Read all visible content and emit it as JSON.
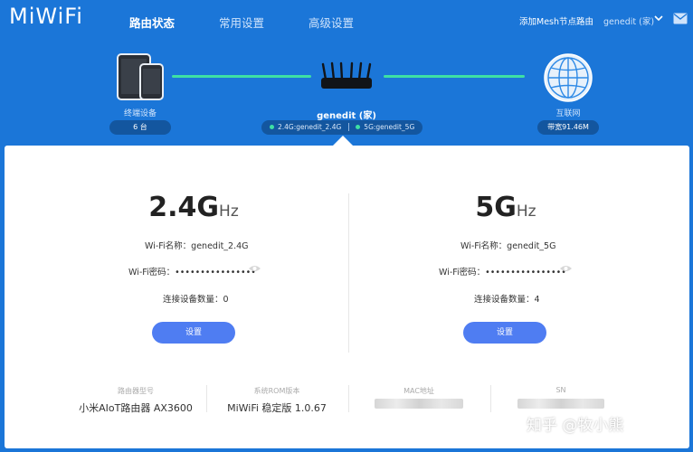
{
  "header": {
    "logo": "MiWiFi",
    "tabs": [
      {
        "label": "路由状态",
        "active": true
      },
      {
        "label": "常用设置",
        "active": false
      },
      {
        "label": "高级设置",
        "active": false
      }
    ],
    "mesh_link": "添加Mesh节点路由",
    "user": "genedit (家)"
  },
  "topology": {
    "devices": {
      "label": "终端设备",
      "count": "6 台"
    },
    "router": {
      "name": "genedit (家)",
      "ssid_24": "2.4G:genedit_2.4G",
      "ssid_5": "5G:genedit_5G"
    },
    "internet": {
      "label": "互联网",
      "bandwidth": "带宽91.46M"
    }
  },
  "bands": [
    {
      "freq": "2.4G",
      "unit": "Hz",
      "wifi_name_label": "Wi-Fi名称：",
      "wifi_name": "genedit_2.4G",
      "pwd_label": "Wi-Fi密码：",
      "pwd_mask": "••••••••••••••••",
      "devices_label": "连接设备数量：",
      "devices_count": "0",
      "button": "设置"
    },
    {
      "freq": "5G",
      "unit": "Hz",
      "wifi_name_label": "Wi-Fi名称：",
      "wifi_name": "genedit_5G",
      "pwd_label": "Wi-Fi密码：",
      "pwd_mask": "••••••••••••••••",
      "devices_label": "连接设备数量：",
      "devices_count": "4",
      "button": "设置"
    }
  ],
  "footer": {
    "model_label": "路由器型号",
    "model_value": "小米AIoT路由器 AX3600",
    "rom_label": "系统ROM版本",
    "rom_value": "MiWiFi 稳定版 1.0.67",
    "mac_label": "MAC地址",
    "sn_label": "SN"
  },
  "watermark": "知乎 @牧小熊",
  "colors": {
    "background": "#1b76d8",
    "link_line": "#3ee0a4",
    "button": "#4f7df2"
  }
}
